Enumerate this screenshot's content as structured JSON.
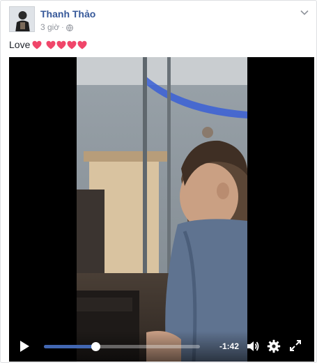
{
  "post": {
    "author": "Thanh Thảo",
    "timestamp": "3 giờ",
    "audience_icon": "globe-icon",
    "text": "Love",
    "heart_count": 5,
    "heart_color": "#f0466a",
    "link_color": "#365899"
  },
  "video": {
    "time_remaining": "-1:42",
    "progress": 0.33,
    "progress_color": "#4267b2",
    "controls": {
      "play_icon": "play-icon",
      "volume_icon": "volume-icon",
      "settings_icon": "gear-icon",
      "fullscreen_icon": "fullscreen-icon"
    }
  }
}
